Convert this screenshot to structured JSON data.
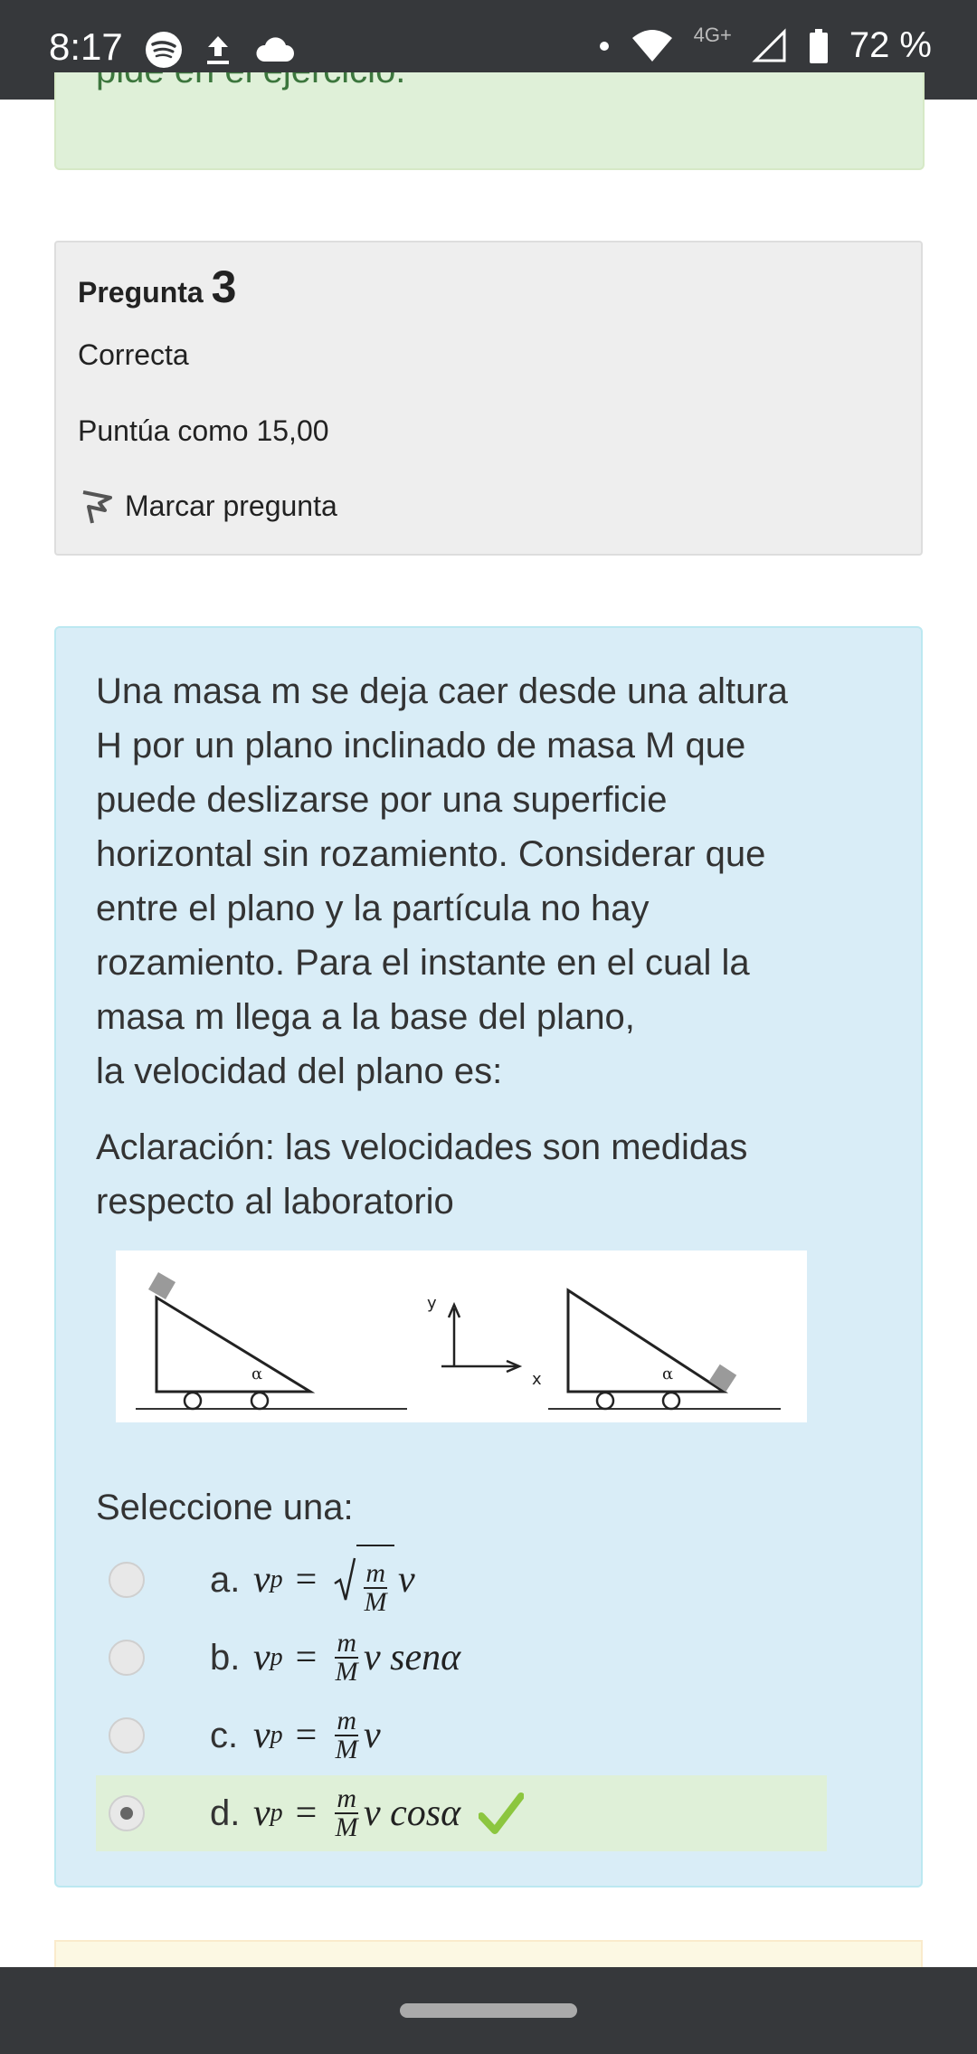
{
  "status_bar": {
    "time": "8:17",
    "network": "4G+",
    "battery": "72 %",
    "icons": [
      "spotify-icon",
      "upload-icon",
      "cloud-icon",
      "dot-icon",
      "wifi-icon",
      "signal-icon",
      "battery-icon"
    ]
  },
  "previous_feedback": {
    "text": "pide en el ejercicio."
  },
  "question_info": {
    "title_prefix": "Pregunta",
    "number": "3",
    "state": "Correcta",
    "grade": "Puntúa como 15,00",
    "flag_label": "Marcar pregunta"
  },
  "question": {
    "text_lines": [
      "Una masa m se deja caer desde una altura",
      "H por un plano inclinado de masa M que",
      "puede deslizarse por una superficie",
      "horizontal sin rozamiento. Considerar que",
      "entre el plano y la partícula no hay",
      "rozamiento. Para el instante en el cual la",
      "masa m llega a la base del plano,",
      "la velocidad del plano es:"
    ],
    "note_lines": [
      "Aclaración: las velocidades son medidas",
      "respecto al laboratorio"
    ],
    "figure": {
      "angle_label": "α",
      "axis_x": "x",
      "axis_y": "y"
    },
    "prompt": "Seleccione una:",
    "answers": [
      {
        "letter": "a.",
        "lhs": "v",
        "sub": "p",
        "num": "m",
        "den": "M",
        "rest": "v",
        "selected": false
      },
      {
        "letter": "b.",
        "lhs": "v",
        "sub": "p",
        "num": "m",
        "den": "M",
        "rest": "v senα",
        "selected": false
      },
      {
        "letter": "c.",
        "lhs": "v",
        "sub": "p",
        "num": "m",
        "den": "M",
        "rest": "v",
        "selected": false
      },
      {
        "letter": "d.",
        "lhs": "v",
        "sub": "p",
        "num": "m",
        "den": "M",
        "rest": "v cosα",
        "selected": true,
        "correct": true
      }
    ]
  },
  "colors": {
    "status_bar": "#36383b",
    "correct_bg": "#dff0d8",
    "question_bg": "#d9edf7",
    "info_bg": "#eeeeee",
    "check_green": "#8cc63f"
  }
}
